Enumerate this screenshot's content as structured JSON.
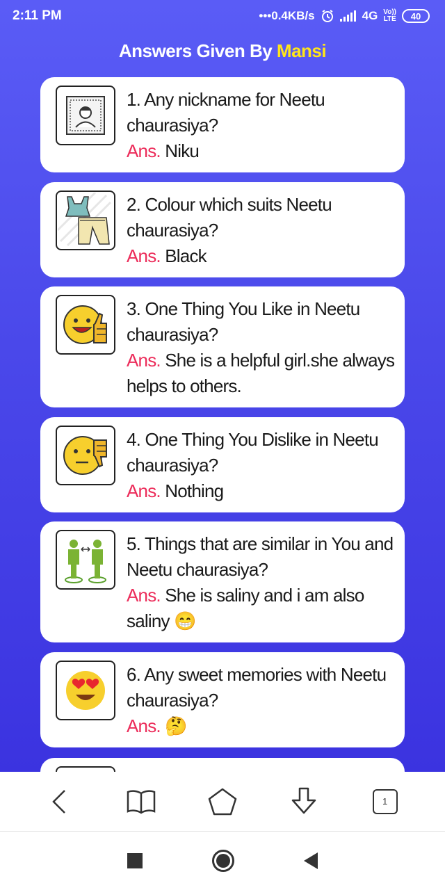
{
  "status": {
    "time": "2:11 PM",
    "speed": "•••0.4KB/s",
    "network": "4G",
    "lte_top": "Vo))",
    "lte_bottom": "LTE",
    "battery": "40"
  },
  "header": {
    "title_prefix": "Answers Given By",
    "name": "Mansi"
  },
  "answer_label": "Ans.",
  "cards": [
    {
      "question": "1. Any nickname for Neetu chaurasiya?",
      "answer": "Niku",
      "icon": "portrait-icon"
    },
    {
      "question": "2. Colour which suits Neetu chaurasiya?",
      "answer": "Black",
      "icon": "clothes-icon"
    },
    {
      "question": "3. One Thing You Like in Neetu chaurasiya?",
      "answer": "She is a helpful girl.she always helps to others.",
      "icon": "thumbs-up-emoji-icon"
    },
    {
      "question": "4. One Thing You Dislike in Neetu chaurasiya?",
      "answer": "Nothing",
      "icon": "thumbs-down-emoji-icon"
    },
    {
      "question": "5. Things that are similar in You and Neetu chaurasiya?",
      "answer": "She is saliny and i am also saliny 😁",
      "icon": "two-people-icon"
    },
    {
      "question": "6. Any sweet memories with Neetu chaurasiya?",
      "answer": "🤔",
      "icon": "heart-eyes-emoji-icon"
    }
  ],
  "browser_nav": {
    "tab_count": "1"
  },
  "colors": {
    "background_top": "#5a5cf6",
    "background_bottom": "#3b33e0",
    "name_highlight": "#ffe51a",
    "answer_label": "#ec2c5a"
  }
}
